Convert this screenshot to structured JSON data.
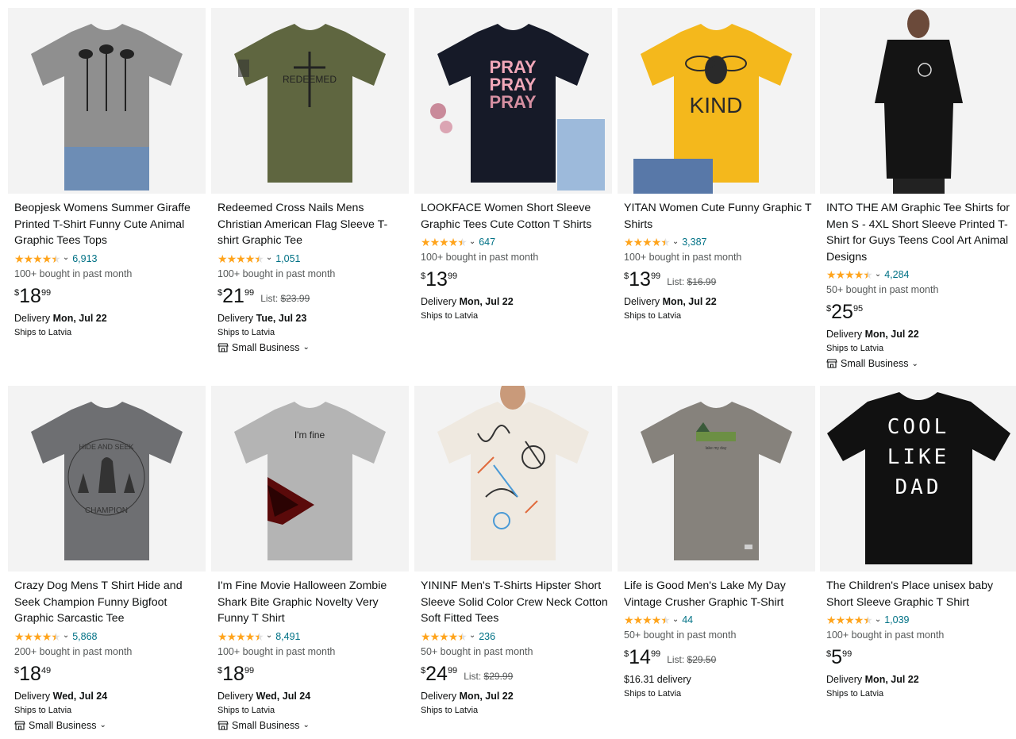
{
  "products": [
    {
      "title": "Beopjesk Womens Summer Giraffe Printed T-Shirt Funny Cute Animal Graphic Tees Tops",
      "stars": 4.5,
      "rating_count": "6,913",
      "bought": "100+ bought in past month",
      "price_currency": "$",
      "price_whole": "18",
      "price_fraction": "99",
      "list_label": "",
      "list_price": "",
      "delivery_label": "Delivery",
      "delivery_date": "Mon, Jul 22",
      "ships": "Ships to Latvia",
      "small_business": "",
      "image": "giraffe-tshirt-image",
      "shirt_color": "#8f8f8f"
    },
    {
      "title": "Redeemed Cross Nails Mens Christian American Flag Sleeve T-shirt Graphic Tee",
      "stars": 4.5,
      "rating_count": "1,051",
      "bought": "100+ bought in past month",
      "price_currency": "$",
      "price_whole": "21",
      "price_fraction": "99",
      "list_label": "List:",
      "list_price": "$23.99",
      "delivery_label": "Delivery",
      "delivery_date": "Tue, Jul 23",
      "ships": "Ships to Latvia",
      "small_business": "Small Business",
      "image": "redeemed-cross-tshirt-image",
      "shirt_color": "#5f6640",
      "print_text": "REDEEMED"
    },
    {
      "title": "LOOKFACE Women Short Sleeve Graphic Tees Cute Cotton T Shirts",
      "stars": 4.5,
      "rating_count": "647",
      "bought": "100+ bought in past month",
      "price_currency": "$",
      "price_whole": "13",
      "price_fraction": "99",
      "list_label": "",
      "list_price": "",
      "delivery_label": "Delivery",
      "delivery_date": "Mon, Jul 22",
      "ships": "Ships to Latvia",
      "small_business": "",
      "image": "pray-tshirt-image",
      "shirt_color": "#161a28",
      "print_text": "PRAY"
    },
    {
      "title": "YITAN Women Cute Funny Graphic T Shirts",
      "stars": 4.5,
      "rating_count": "3,387",
      "bought": "100+ bought in past month",
      "price_currency": "$",
      "price_whole": "13",
      "price_fraction": "99",
      "list_label": "List:",
      "list_price": "$16.99",
      "delivery_label": "Delivery",
      "delivery_date": "Mon, Jul 22",
      "ships": "Ships to Latvia",
      "small_business": "",
      "image": "bee-kind-tshirt-image",
      "shirt_color": "#f4b81c",
      "print_text": "KIND"
    },
    {
      "title": "INTO THE AM Graphic Tee Shirts for Men S - 4XL Short Sleeve Printed T-Shirt for Guys Teens Cool Art Animal Designs",
      "stars": 4.5,
      "rating_count": "4,284",
      "bought": "50+ bought in past month",
      "price_currency": "$",
      "price_whole": "25",
      "price_fraction": "95",
      "list_label": "",
      "list_price": "",
      "delivery_label": "Delivery",
      "delivery_date": "Mon, Jul 22",
      "ships": "Ships to Latvia",
      "small_business": "Small Business",
      "image": "black-graphic-tee-model-image",
      "shirt_color": "#141414"
    },
    {
      "title": "Crazy Dog Mens T Shirt Hide and Seek Champion Funny Bigfoot Graphic Sarcastic Tee",
      "stars": 4.5,
      "rating_count": "5,868",
      "bought": "200+ bought in past month",
      "price_currency": "$",
      "price_whole": "18",
      "price_fraction": "49",
      "list_label": "",
      "list_price": "",
      "delivery_label": "Delivery",
      "delivery_date": "Wed, Jul 24",
      "ships": "Ships to Latvia",
      "small_business": "Small Business",
      "image": "hide-and-seek-champion-tshirt-image",
      "shirt_color": "#6e6f72"
    },
    {
      "title": "I'm Fine Movie Halloween Zombie Shark Bite Graphic Novelty Very Funny T Shirt",
      "stars": 4.5,
      "rating_count": "8,491",
      "bought": "100+ bought in past month",
      "price_currency": "$",
      "price_whole": "18",
      "price_fraction": "99",
      "list_label": "",
      "list_price": "",
      "delivery_label": "Delivery",
      "delivery_date": "Wed, Jul 24",
      "ships": "Ships to Latvia",
      "small_business": "Small Business",
      "image": "im-fine-tshirt-image",
      "shirt_color": "#b4b4b4",
      "print_text": "I'm fine"
    },
    {
      "title": "YININF Men's T-Shirts Hipster Short Sleeve Solid Color Crew Neck Cotton Soft Fitted Tees",
      "stars": 4.5,
      "rating_count": "236",
      "bought": "50+ bought in past month",
      "price_currency": "$",
      "price_whole": "24",
      "price_fraction": "99",
      "list_label": "List:",
      "list_price": "$29.99",
      "delivery_label": "Delivery",
      "delivery_date": "Mon, Jul 22",
      "ships": "Ships to Latvia",
      "small_business": "",
      "image": "graffiti-print-tshirt-model-image",
      "shirt_color": "#efe9e0"
    },
    {
      "title": "Life is Good Men's Lake My Day Vintage Crusher Graphic T-Shirt",
      "stars": 4.5,
      "rating_count": "44",
      "bought": "50+ bought in past month",
      "price_currency": "$",
      "price_whole": "14",
      "price_fraction": "99",
      "list_label": "List:",
      "list_price": "$29.50",
      "delivery_label": "",
      "delivery_date": "$16.31 delivery",
      "ships": "Ships to Latvia",
      "small_business": "",
      "image": "lake-my-day-tshirt-image",
      "shirt_color": "#86827c"
    },
    {
      "title": "The Children's Place unisex baby Short Sleeve Graphic T Shirt",
      "stars": 4.5,
      "rating_count": "1,039",
      "bought": "100+ bought in past month",
      "price_currency": "$",
      "price_whole": "5",
      "price_fraction": "99",
      "list_label": "",
      "list_price": "",
      "delivery_label": "Delivery",
      "delivery_date": "Mon, Jul 22",
      "ships": "Ships to Latvia",
      "small_business": "",
      "image": "cool-like-dad-tshirt-image",
      "shirt_color": "#111111",
      "print_text": "COOL LIKE DAD"
    }
  ],
  "colors": {
    "star": "#ffa41c",
    "link": "#007185",
    "muted": "#565959",
    "image_bg": "#f3f3f3"
  }
}
